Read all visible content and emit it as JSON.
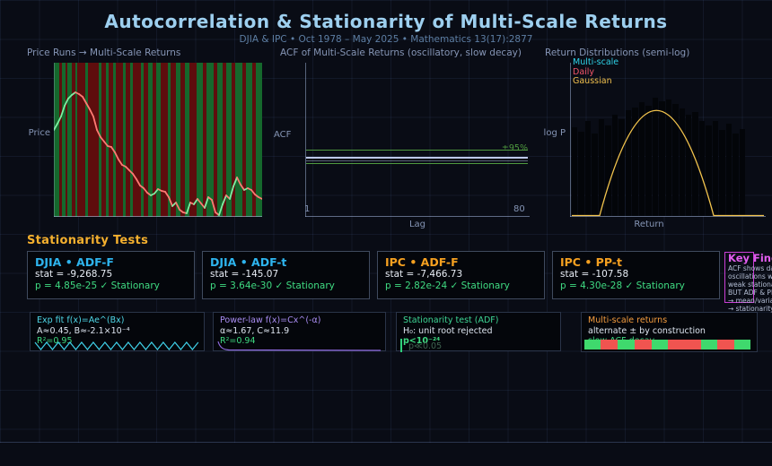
{
  "header": {
    "title": "Autocorrelation & Stationarity of Multi-Scale Returns",
    "subtitle": "DJIA & IPC  •  Oct 1978 – May 2025  •  Mathematics 13(17):2877"
  },
  "chart_data": [
    {
      "type": "line",
      "title": "Price Runs → Multi-Scale Returns",
      "ylabel": "Price",
      "note": "price path over alternating up/down run bands; line segments green when rising, red when falling",
      "band_green": "#15682c",
      "band_red": "#5e0d0d",
      "up_color": "#7cf0a2",
      "down_color": "#ff7a73",
      "bands": [
        [
          "g",
          6
        ],
        [
          "r",
          3
        ],
        [
          "g",
          4
        ],
        [
          "r",
          2
        ],
        [
          "g",
          5
        ],
        [
          "r",
          4
        ],
        [
          "g",
          2
        ],
        [
          "r",
          9
        ],
        [
          "g",
          3
        ],
        [
          "r",
          12
        ],
        [
          "g",
          3
        ],
        [
          "r",
          5
        ],
        [
          "g",
          3
        ],
        [
          "r",
          5
        ],
        [
          "g",
          3
        ],
        [
          "r",
          8
        ],
        [
          "g",
          3
        ],
        [
          "r",
          5
        ],
        [
          "g",
          3
        ],
        [
          "r",
          9
        ],
        [
          "g",
          3
        ],
        [
          "r",
          5
        ],
        [
          "g",
          5
        ],
        [
          "r",
          4
        ],
        [
          "g",
          5
        ],
        [
          "r",
          8
        ],
        [
          "g",
          3
        ],
        [
          "r",
          6
        ],
        [
          "g",
          5
        ],
        [
          "r",
          5
        ],
        [
          "g",
          5
        ],
        [
          "r",
          8
        ],
        [
          "g",
          7
        ],
        [
          "r",
          4
        ],
        [
          "g",
          8
        ],
        [
          "r",
          4
        ],
        [
          "g",
          6
        ],
        [
          "r",
          4
        ],
        [
          "g",
          6
        ],
        [
          "r",
          4
        ],
        [
          "g",
          8
        ],
        [
          "r",
          4
        ],
        [
          "g",
          7
        ],
        [
          "r",
          4
        ],
        [
          "g",
          7
        ]
      ],
      "series": [
        {
          "name": "price",
          "points": [
            [
              0,
              75
            ],
            [
              4,
              68
            ],
            [
              8,
              60
            ],
            [
              12,
              48
            ],
            [
              16,
              40
            ],
            [
              20,
              36
            ],
            [
              24,
              33
            ],
            [
              28,
              35
            ],
            [
              32,
              38
            ],
            [
              36,
              45
            ],
            [
              40,
              52
            ],
            [
              44,
              60
            ],
            [
              48,
              75
            ],
            [
              52,
              83
            ],
            [
              56,
              88
            ],
            [
              60,
              93
            ],
            [
              64,
              94
            ],
            [
              68,
              100
            ],
            [
              72,
              108
            ],
            [
              76,
              114
            ],
            [
              80,
              116
            ],
            [
              84,
              120
            ],
            [
              88,
              124
            ],
            [
              92,
              130
            ],
            [
              96,
              137
            ],
            [
              100,
              140
            ],
            [
              104,
              145
            ],
            [
              108,
              148
            ],
            [
              112,
              146
            ],
            [
              116,
              141
            ],
            [
              120,
              143
            ],
            [
              124,
              144
            ],
            [
              128,
              150
            ],
            [
              132,
              160
            ],
            [
              136,
              156
            ],
            [
              140,
              164
            ],
            [
              144,
              167
            ],
            [
              148,
              168
            ],
            [
              152,
              156
            ],
            [
              156,
              158
            ],
            [
              160,
              152
            ],
            [
              164,
              157
            ],
            [
              168,
              162
            ],
            [
              172,
              150
            ],
            [
              176,
              153
            ],
            [
              180,
              167
            ],
            [
              184,
              170
            ],
            [
              188,
              158
            ],
            [
              192,
              148
            ],
            [
              196,
              152
            ],
            [
              200,
              138
            ],
            [
              204,
              128
            ],
            [
              208,
              136
            ],
            [
              212,
              142
            ],
            [
              216,
              140
            ],
            [
              220,
              142
            ],
            [
              224,
              147
            ],
            [
              228,
              150
            ],
            [
              232,
              152
            ]
          ]
        }
      ]
    },
    {
      "type": "line",
      "title": "ACF of Multi-Scale Returns  (oscillatory, slow decay)",
      "xlabel": "Lag",
      "ylabel": "ACF",
      "xlim": [
        1,
        80
      ],
      "tick_start": "1",
      "tick_end": "80",
      "conf_label": "±95%",
      "conf_color": "#4f9a3f",
      "line_color": "#bcc8e8",
      "acf_values": "≈ 0 for all lags 1–80 (flat near zero, inside ±95% confidence band)"
    },
    {
      "type": "bar",
      "title": "Return Distributions  (semi-log)",
      "xlabel": "Return",
      "ylabel": "log P",
      "legend": [
        {
          "label": "Multi-scale",
          "color": "#2ed3e8"
        },
        {
          "label": "Daily",
          "color": "#f25569"
        },
        {
          "label": "Gaussian",
          "color": "#f2c14e"
        }
      ],
      "bar_color": "#030509",
      "bars": [
        0.58,
        0.55,
        0.62,
        0.54,
        0.63,
        0.59,
        0.66,
        0.63,
        0.69,
        0.71,
        0.74,
        0.72,
        0.77,
        0.75,
        0.76,
        0.73,
        0.7,
        0.66,
        0.68,
        0.62,
        0.59,
        0.62,
        0.56,
        0.6,
        0.54,
        0.57
      ],
      "gaussian": {
        "color": "#f3c44d",
        "flat_start": 2,
        "x0": 33,
        "ctrl_x": 96,
        "ctrl_y": -64,
        "x1": 160,
        "flat_end": 216,
        "base": 170.5
      }
    }
  ],
  "tests": {
    "heading": "Stationarity Tests",
    "cards": [
      {
        "title": "DJIA • ADF-F",
        "title_color": "#2eb4ee",
        "stat": "stat = -9,268.75",
        "p": "p = 4.85e-25  ✓ Stationary"
      },
      {
        "title": "DJIA • ADF-t",
        "title_color": "#2eb4ee",
        "stat": "stat = -145.07",
        "p": "p = 3.64e-30  ✓ Stationary"
      },
      {
        "title": "IPC • ADF-F",
        "title_color": "#f5a020",
        "stat": "stat = -7,466.73",
        "p": "p = 2.82e-24  ✓ Stationary"
      },
      {
        "title": "IPC • PP-t",
        "title_color": "#f5a020",
        "stat": "stat = -107.58",
        "p": "p = 4.30e-28  ✓ Stationary"
      }
    ]
  },
  "key_box": {
    "title": "Key Findings",
    "lines": [
      "ACF shows damped",
      "oscillations with",
      "weak stationarity",
      "BUT ADF & PP tests",
      "→ mean/variance",
      "→ stationarity"
    ]
  },
  "footnotes": [
    {
      "title": "Exp fit  f(x)=Ae^(Bx)",
      "title_color": "#4fd8e8",
      "line2": "A≈0.45, B≈-2.1×10⁻⁴",
      "line3": "R²=0.95",
      "spark": "zigzag",
      "spark_color": "#3fd0e8"
    },
    {
      "title": "Power-law  f(x)=Cx^(-α)",
      "title_color": "#a98df2",
      "line2": "α≈1.67, C≈11.9",
      "line3": "R²=0.94",
      "spark": "decay",
      "spark_color": "#8f6ae0"
    },
    {
      "title": "Stationarity test (ADF)",
      "title_color": "#3ed695",
      "line2": "H₀: unit root rejected",
      "line3": "p<10⁻²⁴",
      "spark": "tick",
      "spark_color": "#2fd07a",
      "dim_label": "p≪0.05"
    },
    {
      "title": "Multi-scale returns",
      "title_color": "#f59d3f",
      "line2": "alternate ± by construction",
      "line3": "slow ACF decay",
      "spark": "strip",
      "strip": [
        [
          "#3fd96d",
          18
        ],
        [
          "#f05450",
          20
        ],
        [
          "#3fd96d",
          19
        ],
        [
          "#f05450",
          20
        ],
        [
          "#3fd96d",
          18
        ],
        [
          "#f05450",
          38
        ],
        [
          "#3fd96d",
          19
        ],
        [
          "#f05450",
          20
        ],
        [
          "#3fd96d",
          18
        ]
      ]
    }
  ]
}
